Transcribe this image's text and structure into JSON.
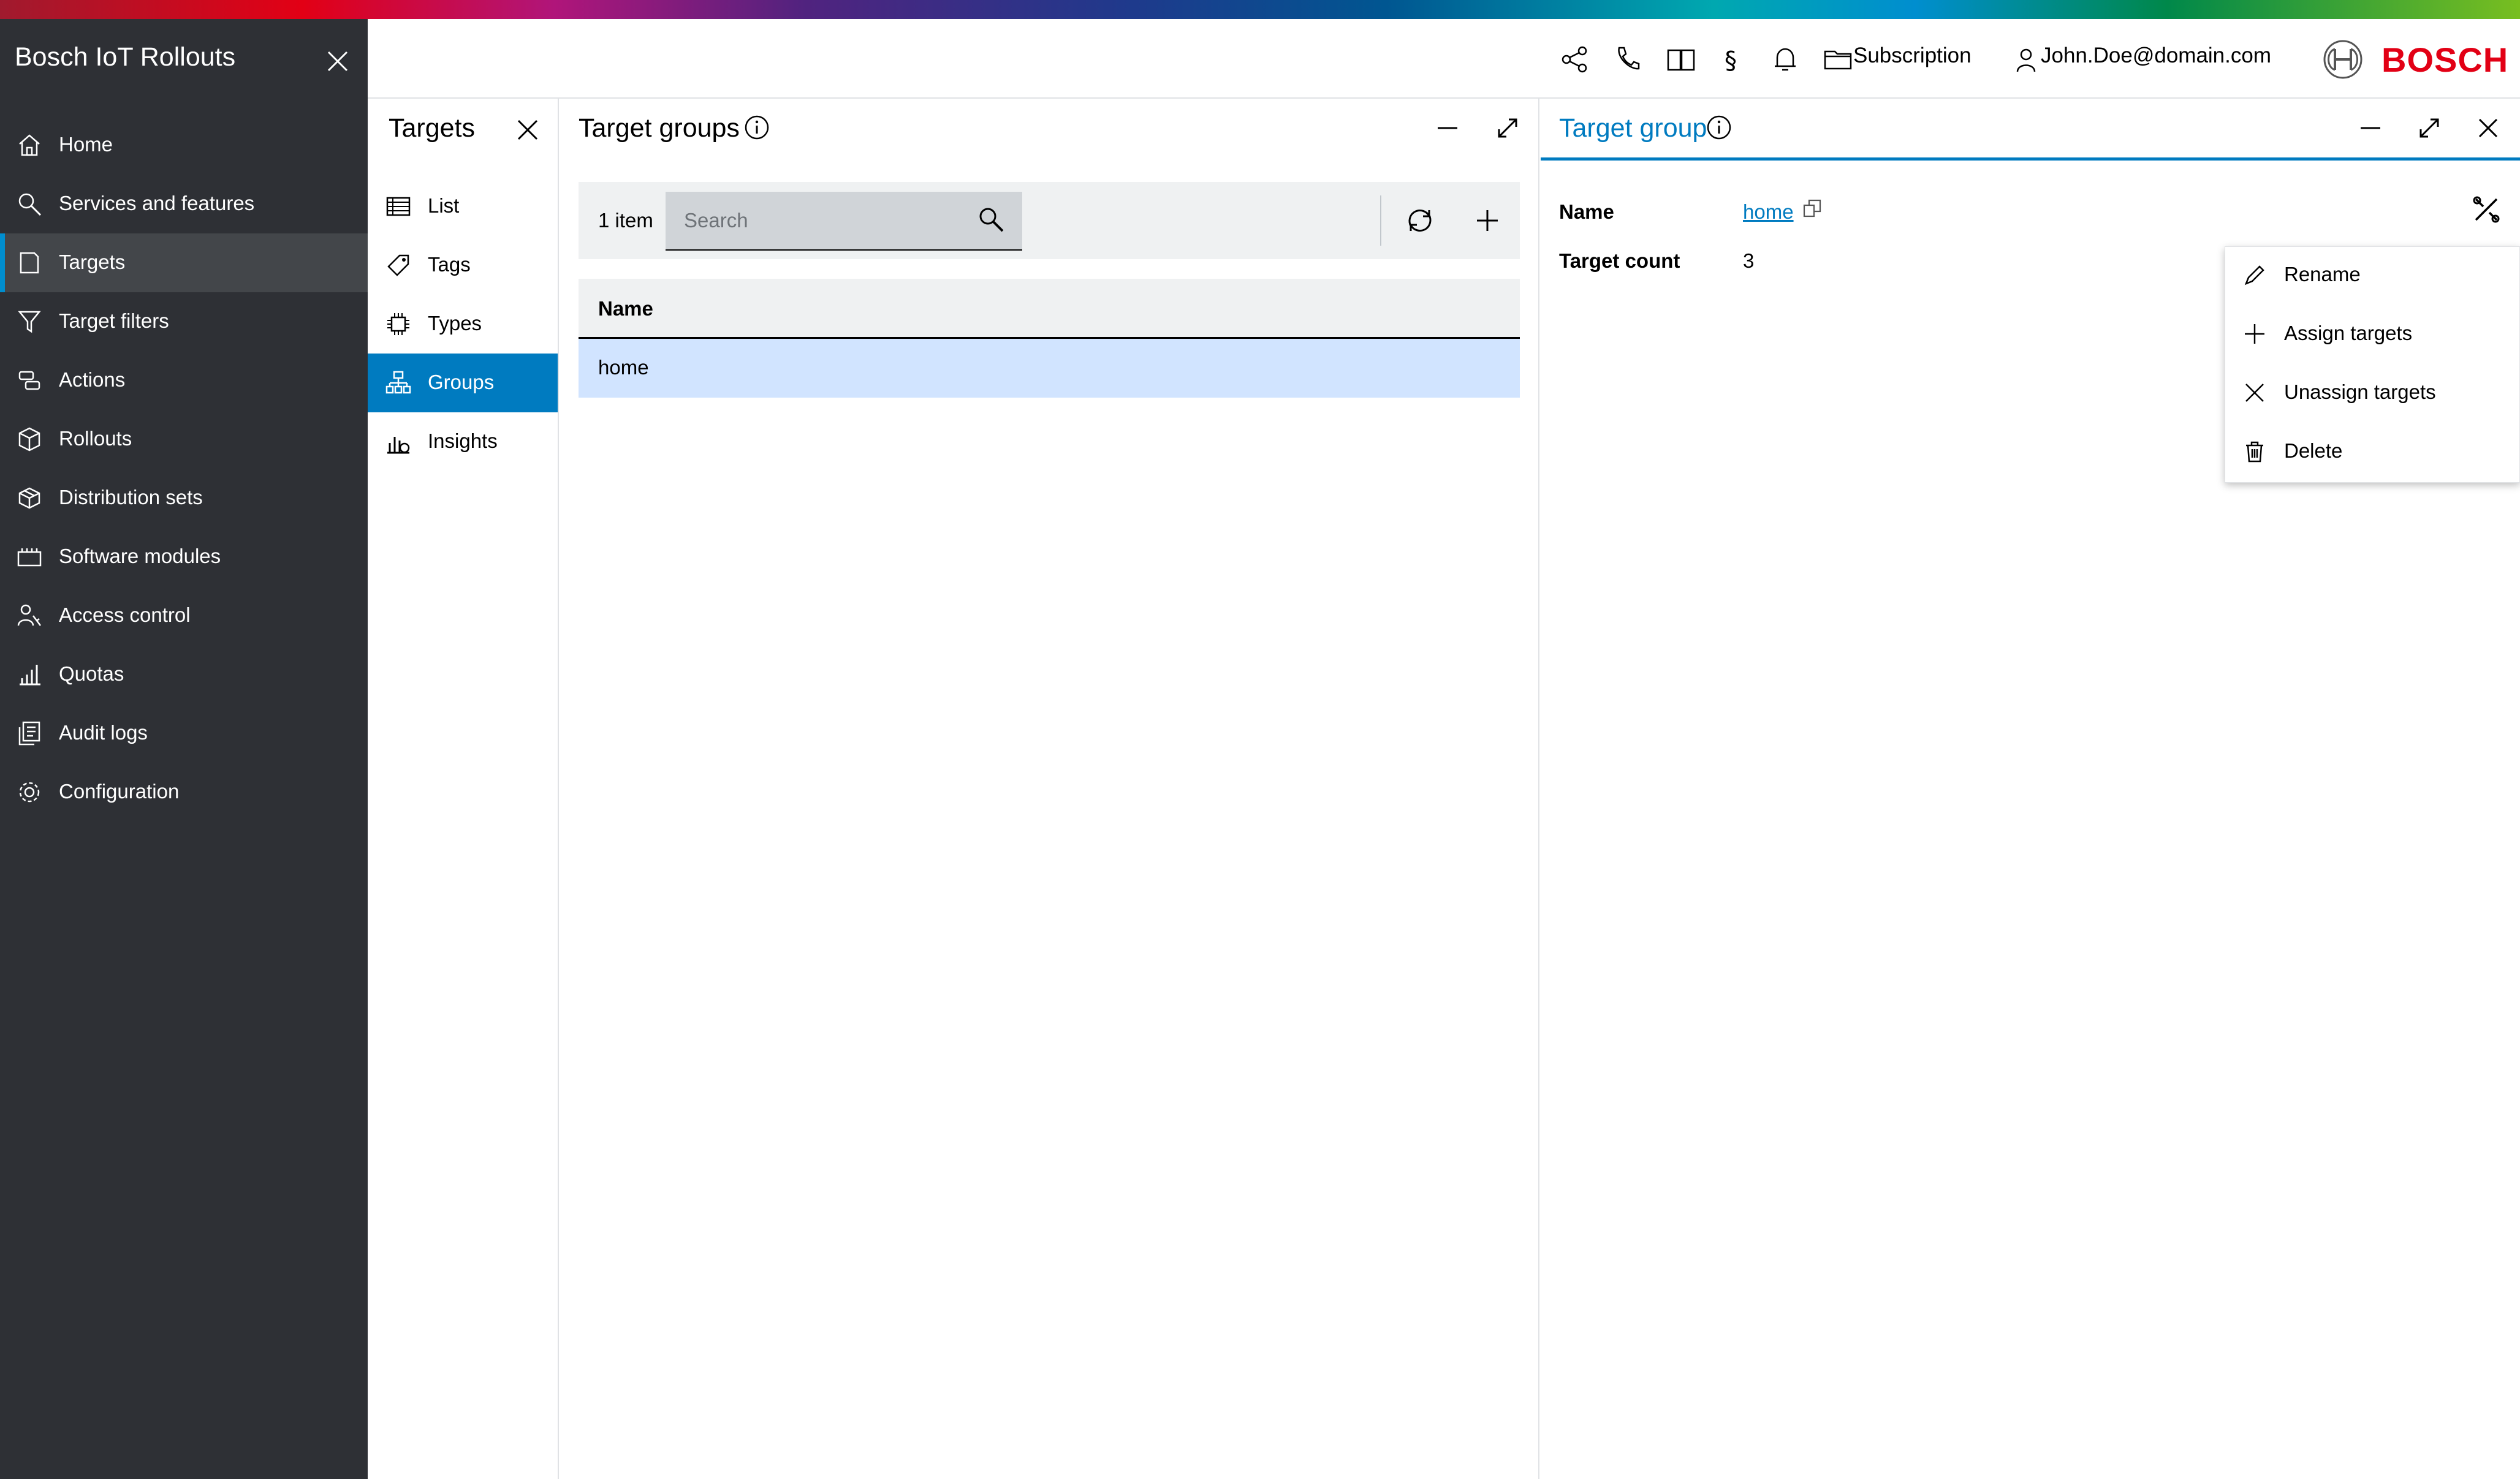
{
  "app": {
    "title": "Bosch IoT Rollouts"
  },
  "sidebar": {
    "items": [
      {
        "label": "Home",
        "icon": "home-icon"
      },
      {
        "label": "Services and features",
        "icon": "magnifier-icon"
      },
      {
        "label": "Targets",
        "icon": "target-icon",
        "active": true
      },
      {
        "label": "Target filters",
        "icon": "filter-icon"
      },
      {
        "label": "Actions",
        "icon": "actions-icon"
      },
      {
        "label": "Rollouts",
        "icon": "box-icon"
      },
      {
        "label": "Distribution sets",
        "icon": "package-icon"
      },
      {
        "label": "Software modules",
        "icon": "module-icon"
      },
      {
        "label": "Access control",
        "icon": "user-key-icon"
      },
      {
        "label": "Quotas",
        "icon": "bar-chart-icon"
      },
      {
        "label": "Audit logs",
        "icon": "log-icon"
      },
      {
        "label": "Configuration",
        "icon": "gear-icon"
      }
    ]
  },
  "topbar": {
    "subscription": "Subscription",
    "user": "John.Doe@domain.com",
    "brand": "BOSCH"
  },
  "subnav": {
    "title": "Targets",
    "items": [
      {
        "label": "List",
        "icon": "list-icon"
      },
      {
        "label": "Tags",
        "icon": "tag-icon"
      },
      {
        "label": "Types",
        "icon": "chip-icon"
      },
      {
        "label": "Groups",
        "icon": "hierarchy-icon",
        "active": true
      },
      {
        "label": "Insights",
        "icon": "insights-icon"
      }
    ]
  },
  "groups_panel": {
    "title": "Target groups",
    "item_count": "1 item",
    "search_placeholder": "Search",
    "table": {
      "columns": [
        "Name"
      ],
      "rows": [
        {
          "name": "home",
          "selected": true
        }
      ]
    }
  },
  "detail_panel": {
    "title": "Target group",
    "fields": [
      {
        "label": "Name",
        "value": "home",
        "link": true
      },
      {
        "label": "Target count",
        "value": "3"
      }
    ],
    "menu": [
      {
        "label": "Rename",
        "icon": "pencil-icon"
      },
      {
        "label": "Assign targets",
        "icon": "plus-icon"
      },
      {
        "label": "Unassign targets",
        "icon": "close-icon"
      },
      {
        "label": "Delete",
        "icon": "trash-icon"
      }
    ]
  },
  "colors": {
    "sidebar_bg": "#2e3035",
    "accent": "#007bc0",
    "selected_row": "#d1e4ff",
    "brand_red": "#e20015"
  }
}
